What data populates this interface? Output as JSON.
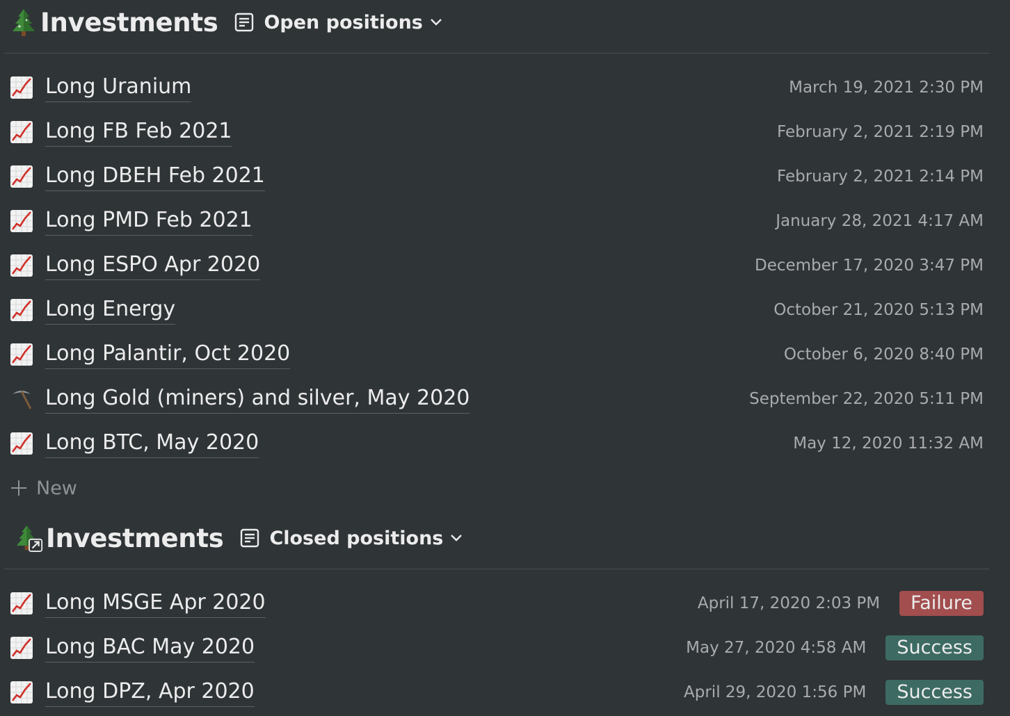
{
  "open": {
    "title": "Investments",
    "view_label": "Open positions",
    "icon": "tree-icon",
    "rows": [
      {
        "title": "Long Uranium",
        "date": "March 19, 2021 2:30 PM",
        "icon": "chart-increasing-icon"
      },
      {
        "title": "Long FB Feb 2021",
        "date": "February 2, 2021 2:19 PM",
        "icon": "chart-increasing-icon"
      },
      {
        "title": "Long DBEH Feb 2021",
        "date": "February 2, 2021 2:14 PM",
        "icon": "chart-increasing-icon"
      },
      {
        "title": "Long PMD Feb 2021",
        "date": "January 28, 2021 4:17 AM",
        "icon": "chart-increasing-icon"
      },
      {
        "title": "Long ESPO Apr 2020",
        "date": "December 17, 2020 3:47 PM",
        "icon": "chart-increasing-icon"
      },
      {
        "title": "Long Energy",
        "date": "October 21, 2020 5:13 PM",
        "icon": "chart-increasing-icon"
      },
      {
        "title": "Long Palantir, Oct 2020",
        "date": "October 6, 2020 8:40 PM",
        "icon": "chart-increasing-icon"
      },
      {
        "title": "Long Gold (miners) and silver, May 2020",
        "date": "September 22, 2020 5:11 PM",
        "icon": "pick-icon"
      },
      {
        "title": "Long BTC, May 2020",
        "date": "May 12, 2020 11:32 AM",
        "icon": "chart-increasing-icon"
      }
    ],
    "new_label": "New"
  },
  "closed": {
    "title": "Investments",
    "view_label": "Closed positions",
    "icon": "tree-linked-icon",
    "rows": [
      {
        "title": "Long MSGE Apr 2020",
        "date": "April 17, 2020 2:03 PM",
        "status": "Failure",
        "icon": "chart-increasing-icon"
      },
      {
        "title": "Long BAC May 2020",
        "date": "May 27, 2020 4:58 AM",
        "status": "Success",
        "icon": "chart-increasing-icon"
      },
      {
        "title": "Long DPZ, Apr 2020",
        "date": "April 29, 2020 1:56 PM",
        "status": "Success",
        "icon": "chart-increasing-icon"
      }
    ]
  },
  "colors": {
    "background": "#2f3437",
    "failure": "#a24d4e",
    "success": "#3d6b63"
  }
}
